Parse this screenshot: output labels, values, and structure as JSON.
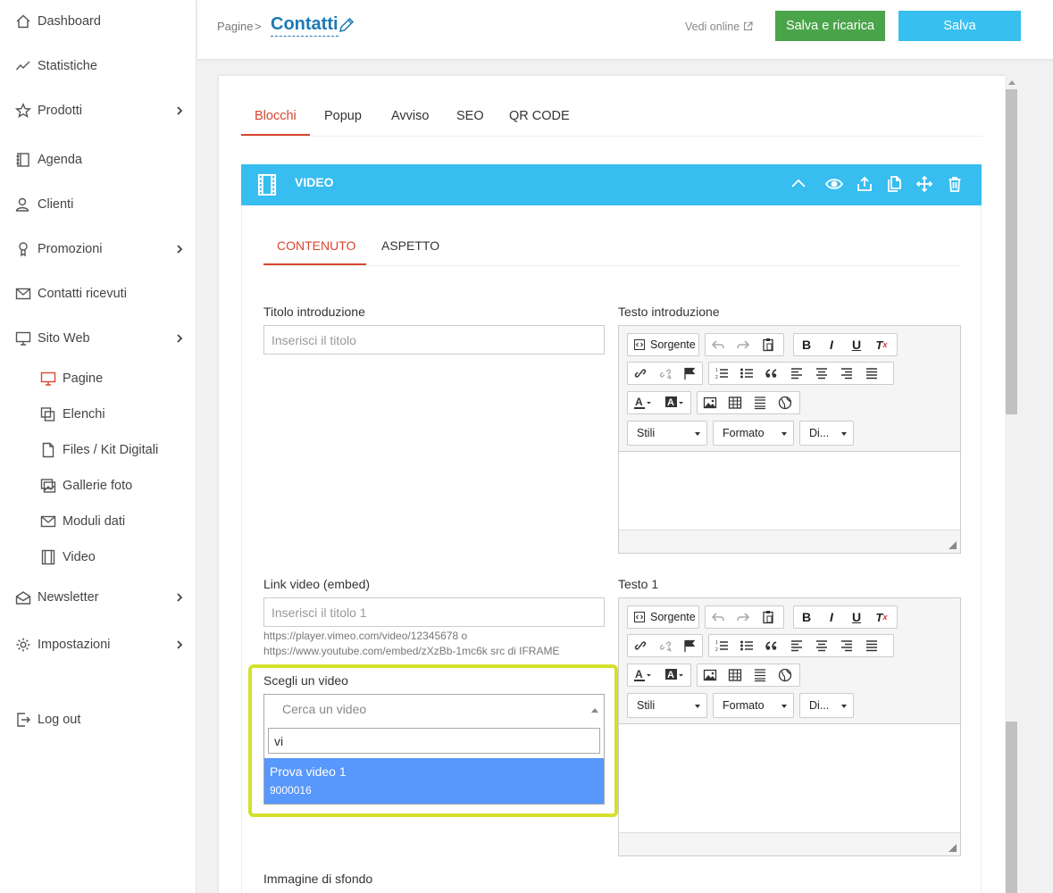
{
  "sidebar": {
    "items": [
      {
        "label": "Dashboard",
        "icon": "home-icon"
      },
      {
        "label": "Statistiche",
        "icon": "chart-line-icon"
      },
      {
        "label": "Prodotti",
        "icon": "star-icon",
        "has_children": true
      },
      {
        "label": "Agenda",
        "icon": "agenda-book-icon"
      },
      {
        "label": "Clienti",
        "icon": "users-icon"
      },
      {
        "label": "Promozioni",
        "icon": "badge-icon",
        "has_children": true
      },
      {
        "label": "Contatti ricevuti",
        "icon": "envelope-icon"
      },
      {
        "label": "Sito Web",
        "icon": "monitor-icon",
        "has_children": true
      },
      {
        "label": "Newsletter",
        "icon": "mail-tray-icon",
        "has_children": true
      },
      {
        "label": "Impostazioni",
        "icon": "gear-icon",
        "has_children": true
      },
      {
        "label": "Log out",
        "icon": "logout-icon"
      }
    ],
    "sito_web_children": [
      {
        "label": "Pagine",
        "icon": "monitor-icon",
        "active": true
      },
      {
        "label": "Elenchi",
        "icon": "copy-icon"
      },
      {
        "label": "Files / Kit Digitali",
        "icon": "file-icon"
      },
      {
        "label": "Gallerie foto",
        "icon": "gallery-icon"
      },
      {
        "label": "Moduli dati",
        "icon": "envelope-icon"
      },
      {
        "label": "Video",
        "icon": "film-icon"
      }
    ]
  },
  "header": {
    "breadcrumb": "Pagine",
    "breadcrumb_separator": ">",
    "page_title": "Contatti",
    "view_online": "Vedi online",
    "save_reload_label": "Salva e ricarica",
    "save_label": "Salva"
  },
  "tabs": [
    "Blocchi",
    "Popup",
    "Avviso",
    "SEO",
    "QR CODE"
  ],
  "block": {
    "title": "VIDEO",
    "subtabs": [
      "CONTENUTO",
      "ASPETTO"
    ]
  },
  "form": {
    "titolo_label": "Titolo introduzione",
    "titolo_placeholder": "Inserisci il titolo",
    "testo_intro_label": "Testo introduzione",
    "link_label": "Link video (embed)",
    "link_placeholder": "Inserisci il titolo 1",
    "link_hint_1": "https://player.vimeo.com/video/12345678 o",
    "link_hint_2": "https://www.youtube.com/embed/zXzBb-1mc6k src di IFRAME",
    "testo1_label": "Testo 1",
    "scegli_label": "Scegli un video",
    "select_placeholder": "Cerca un video",
    "search_value": "vi",
    "option_title": "Prova video 1",
    "option_id": "9000016",
    "immagine_label": "Immagine di sfondo"
  },
  "editor": {
    "source_label": "Sorgente",
    "bold": "B",
    "italic": "I",
    "underline": "U",
    "clear": "Tx",
    "styles_label": "Stili",
    "format_label": "Formato",
    "size_label": "Di..."
  },
  "colors": {
    "accent_blue": "#37bdf0",
    "active_red": "#d9452f",
    "save_green": "#4aa44a",
    "highlight_yellow": "#d4e02c",
    "option_blue": "#5897fb"
  }
}
